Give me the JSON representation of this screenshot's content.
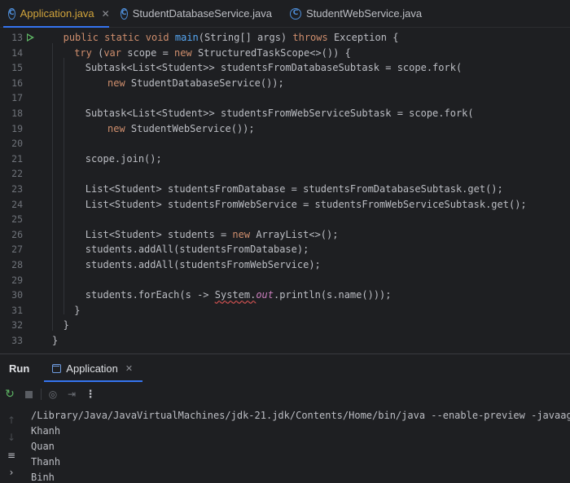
{
  "tabs": [
    {
      "label": "Application.java",
      "active": true,
      "closable": true
    },
    {
      "label": "StudentDatabaseService.java",
      "active": false,
      "closable": false
    },
    {
      "label": "StudentWebService.java",
      "active": false,
      "closable": false
    }
  ],
  "editor": {
    "lines": [
      {
        "num": "13",
        "run": true,
        "indent": 1,
        "tokens": [
          [
            "kw",
            "public static void "
          ],
          [
            "fn",
            "main"
          ],
          [
            "",
            "(String[] args) "
          ],
          [
            "kw",
            "throws"
          ],
          [
            "",
            " Exception {"
          ]
        ]
      },
      {
        "num": "14",
        "run": false,
        "indent": 2,
        "tokens": [
          [
            "kw",
            "try "
          ],
          [
            "",
            "("
          ],
          [
            "kw",
            "var"
          ],
          [
            "",
            " scope = "
          ],
          [
            "kw",
            "new"
          ],
          [
            "",
            " StructuredTaskScope<>()) {"
          ]
        ]
      },
      {
        "num": "15",
        "run": false,
        "indent": 3,
        "tokens": [
          [
            "",
            "Subtask<List<Student>> studentsFromDatabaseSubtask = scope.fork("
          ]
        ]
      },
      {
        "num": "16",
        "run": false,
        "indent": 5,
        "tokens": [
          [
            "kw",
            "new"
          ],
          [
            "",
            " StudentDatabaseService());"
          ]
        ]
      },
      {
        "num": "17",
        "run": false,
        "indent": 0,
        "tokens": []
      },
      {
        "num": "18",
        "run": false,
        "indent": 3,
        "tokens": [
          [
            "",
            "Subtask<List<Student>> studentsFromWebServiceSubtask = scope.fork("
          ]
        ]
      },
      {
        "num": "19",
        "run": false,
        "indent": 5,
        "tokens": [
          [
            "kw",
            "new"
          ],
          [
            "",
            " StudentWebService());"
          ]
        ]
      },
      {
        "num": "20",
        "run": false,
        "indent": 0,
        "tokens": []
      },
      {
        "num": "21",
        "run": false,
        "indent": 3,
        "tokens": [
          [
            "",
            "scope.join();"
          ]
        ]
      },
      {
        "num": "22",
        "run": false,
        "indent": 0,
        "tokens": []
      },
      {
        "num": "23",
        "run": false,
        "indent": 3,
        "tokens": [
          [
            "",
            "List<Student> studentsFromDatabase = studentsFromDatabaseSubtask.get();"
          ]
        ]
      },
      {
        "num": "24",
        "run": false,
        "indent": 3,
        "tokens": [
          [
            "",
            "List<Student> studentsFromWebService = studentsFromWebServiceSubtask.get();"
          ]
        ]
      },
      {
        "num": "25",
        "run": false,
        "indent": 0,
        "tokens": []
      },
      {
        "num": "26",
        "run": false,
        "indent": 3,
        "tokens": [
          [
            "",
            "List<Student> students = "
          ],
          [
            "kw",
            "new"
          ],
          [
            "",
            " ArrayList<>();"
          ]
        ]
      },
      {
        "num": "27",
        "run": false,
        "indent": 3,
        "tokens": [
          [
            "",
            "students.addAll(studentsFromDatabase);"
          ]
        ]
      },
      {
        "num": "28",
        "run": false,
        "indent": 3,
        "tokens": [
          [
            "",
            "students.addAll(studentsFromWebService);"
          ]
        ]
      },
      {
        "num": "29",
        "run": false,
        "indent": 0,
        "tokens": []
      },
      {
        "num": "30",
        "run": false,
        "indent": 3,
        "tokens": [
          [
            "",
            "students.forEach(s -> "
          ],
          [
            "uw",
            "System."
          ],
          [
            "st",
            "out"
          ],
          [
            "",
            ".println(s.name()));"
          ]
        ]
      },
      {
        "num": "31",
        "run": false,
        "indent": 2,
        "tokens": [
          [
            "",
            "}"
          ]
        ]
      },
      {
        "num": "32",
        "run": false,
        "indent": 1,
        "tokens": [
          [
            "",
            "}"
          ]
        ]
      },
      {
        "num": "33",
        "run": false,
        "indent": 0,
        "tokens": [
          [
            "",
            "}"
          ]
        ]
      }
    ]
  },
  "run_panel": {
    "title": "Run",
    "tab_label": "Application",
    "console_lines": [
      "/Library/Java/JavaVirtualMachines/jdk-21.jdk/Contents/Home/bin/java --enable-preview -javaagent:/A",
      "Khanh",
      "Quan",
      "Thanh",
      "Binh"
    ]
  },
  "icons": {
    "tab_file": "java-class-icon",
    "rerun": "rerun-icon",
    "stop": "stop-icon",
    "camera": "camera-icon",
    "exit": "exit-icon",
    "more": "more-vertical-icon",
    "up": "arrow-up-icon",
    "down": "arrow-down-icon",
    "wrap": "soft-wrap-icon",
    "chevron": "chevron-right-icon"
  },
  "colors": {
    "background": "#1e1f22",
    "keyword": "#cf8e6d",
    "method": "#56a8f5",
    "static_field": "#c77dbb",
    "active_tab": "#d0a33b",
    "accent": "#3574f0"
  }
}
